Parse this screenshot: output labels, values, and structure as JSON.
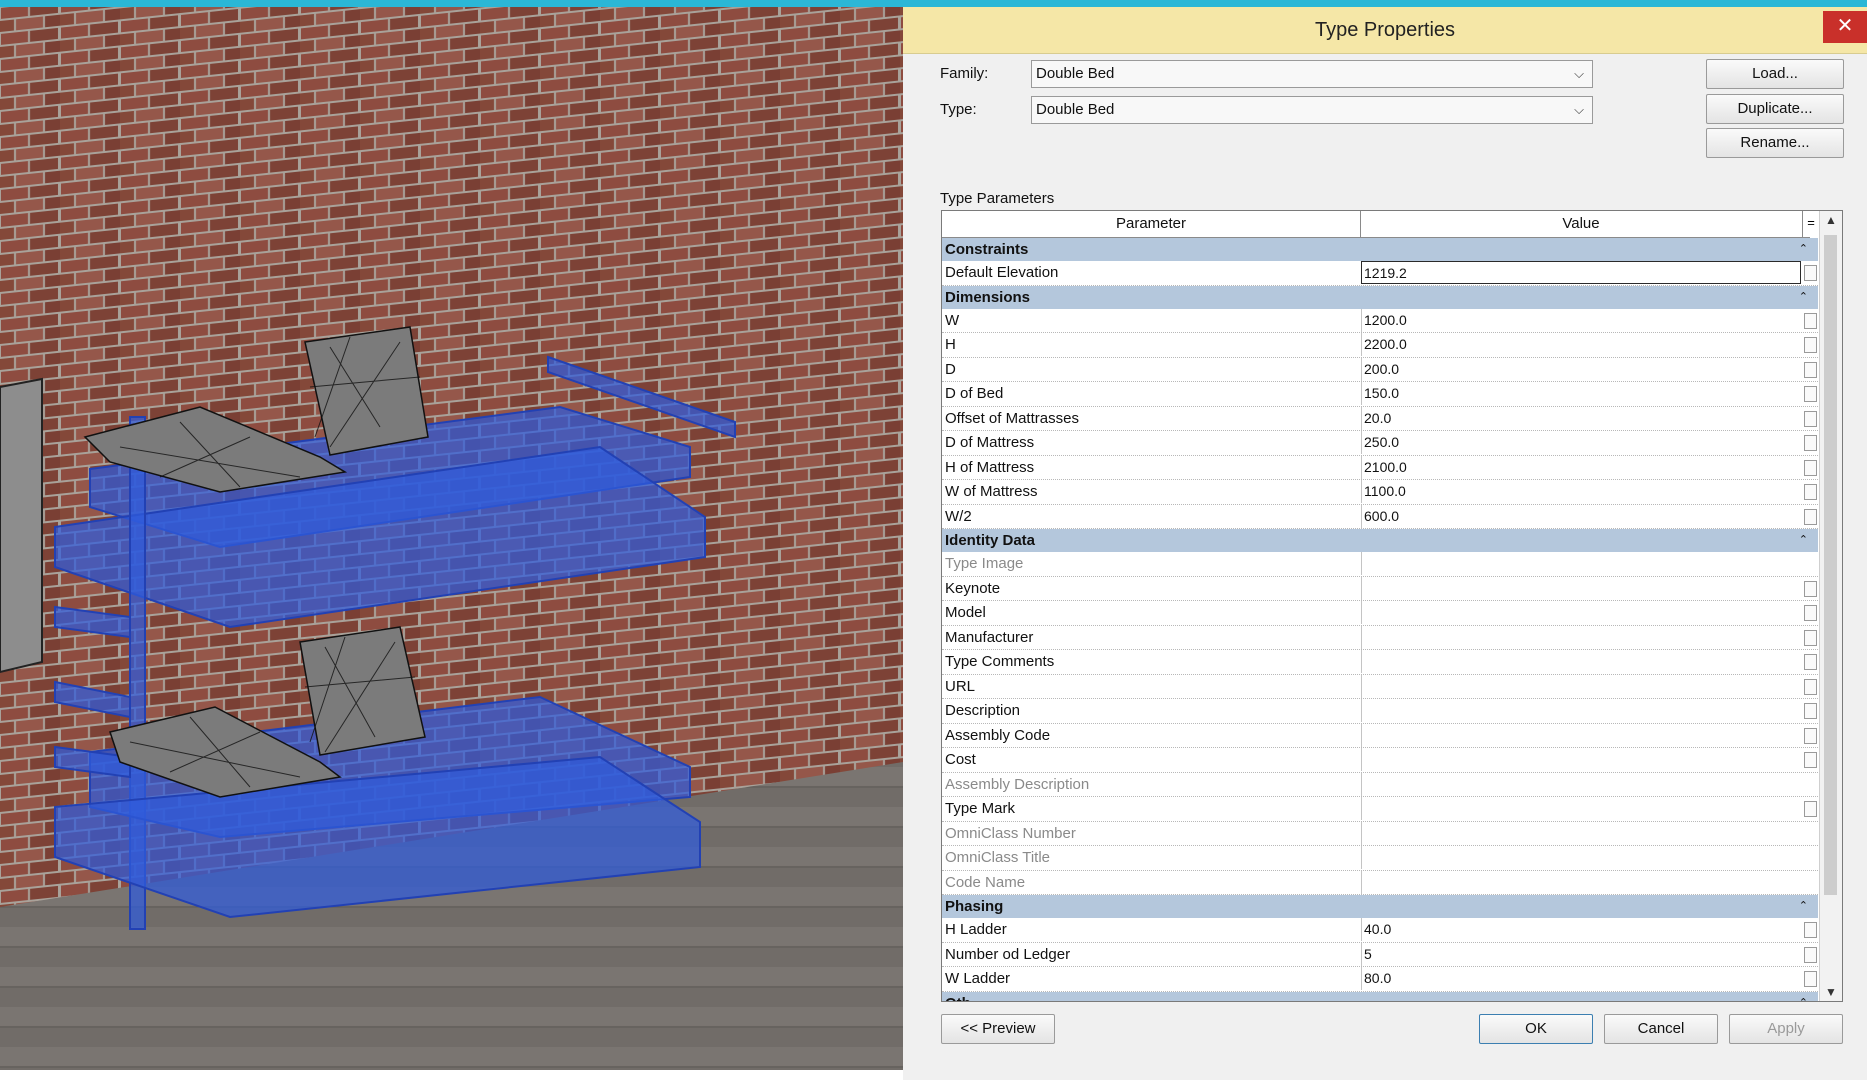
{
  "dialog": {
    "title": "Type Properties",
    "family_label": "Family:",
    "family_value": "Double Bed",
    "type_label": "Type:",
    "type_value": "Double Bed",
    "load_label": "Load...",
    "duplicate_label": "Duplicate...",
    "rename_label": "Rename...",
    "type_parameters_label": "Type Parameters",
    "col_parameter": "Parameter",
    "col_value": "Value",
    "col_eq": "=",
    "preview_label": "<< Preview",
    "ok_label": "OK",
    "cancel_label": "Cancel",
    "apply_label": "Apply"
  },
  "groups": [
    {
      "name": "Constraints",
      "rows": [
        {
          "param": "Default Elevation",
          "value": "1219.2",
          "editing": true
        }
      ]
    },
    {
      "name": "Dimensions",
      "rows": [
        {
          "param": "W",
          "value": "1200.0"
        },
        {
          "param": "H",
          "value": "2200.0"
        },
        {
          "param": "D",
          "value": "200.0"
        },
        {
          "param": "D of Bed",
          "value": "150.0"
        },
        {
          "param": "Offset of Mattrasses",
          "value": "20.0"
        },
        {
          "param": "D of Mattress",
          "value": "250.0"
        },
        {
          "param": "H of Mattress",
          "value": "2100.0"
        },
        {
          "param": "W of Mattress",
          "value": "1100.0"
        },
        {
          "param": "W/2",
          "value": "600.0"
        }
      ]
    },
    {
      "name": "Identity Data",
      "rows": [
        {
          "param": "Type Image",
          "value": "",
          "disabled": true
        },
        {
          "param": "Keynote",
          "value": ""
        },
        {
          "param": "Model",
          "value": ""
        },
        {
          "param": "Manufacturer",
          "value": ""
        },
        {
          "param": "Type Comments",
          "value": ""
        },
        {
          "param": "URL",
          "value": ""
        },
        {
          "param": "Description",
          "value": ""
        },
        {
          "param": "Assembly Code",
          "value": ""
        },
        {
          "param": "Cost",
          "value": ""
        },
        {
          "param": "Assembly Description",
          "value": "",
          "disabled": true
        },
        {
          "param": "Type Mark",
          "value": ""
        },
        {
          "param": "OmniClass Number",
          "value": "",
          "disabled": true
        },
        {
          "param": "OmniClass Title",
          "value": "",
          "disabled": true
        },
        {
          "param": "Code Name",
          "value": "",
          "disabled": true
        }
      ]
    },
    {
      "name": "Phasing",
      "rows": [
        {
          "param": "H Ladder",
          "value": "40.0"
        },
        {
          "param": "Number od Ledger",
          "value": "5"
        },
        {
          "param": "W Ladder",
          "value": "80.0"
        }
      ]
    },
    {
      "name": "Oth",
      "rows": []
    }
  ],
  "viewport": {
    "wall_color": "#8e4c40",
    "floor_color": "#6e6a66",
    "bed_color": "#3b63e0"
  }
}
